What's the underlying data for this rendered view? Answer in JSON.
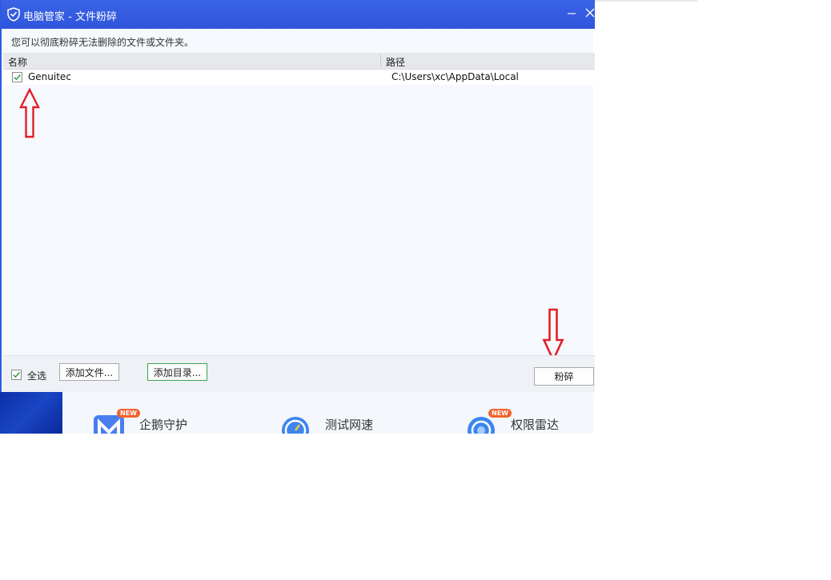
{
  "window": {
    "title": "电脑管家 - 文件粉碎",
    "icon": "shield-check-icon",
    "min_icon": "minimize-icon",
    "close_icon": "close-icon",
    "accent": "#2f55dc"
  },
  "hint": "您可以彻底粉碎无法删除的文件或文件夹。",
  "list": {
    "columns": [
      "名称",
      "路径"
    ],
    "rows": [
      {
        "checked": true,
        "name": "Genuitec",
        "path": "C:\\Users\\xc\\AppData\\Local"
      }
    ]
  },
  "footer": {
    "select_all_label": "全选",
    "select_all_checked": true,
    "add_file_label": "添加文件...",
    "add_dir_label": "添加目录...",
    "shred_label": "粉碎"
  },
  "below_tools": [
    {
      "label": "企鹅守护",
      "badge": "NEW",
      "icon": "penguin-guard-icon"
    },
    {
      "label": "测试网速",
      "badge": "",
      "icon": "speed-test-icon"
    },
    {
      "label": "权限雷达",
      "badge": "NEW",
      "icon": "permission-radar-icon"
    }
  ],
  "annotations": {
    "arrow_color": "#e0202a"
  }
}
